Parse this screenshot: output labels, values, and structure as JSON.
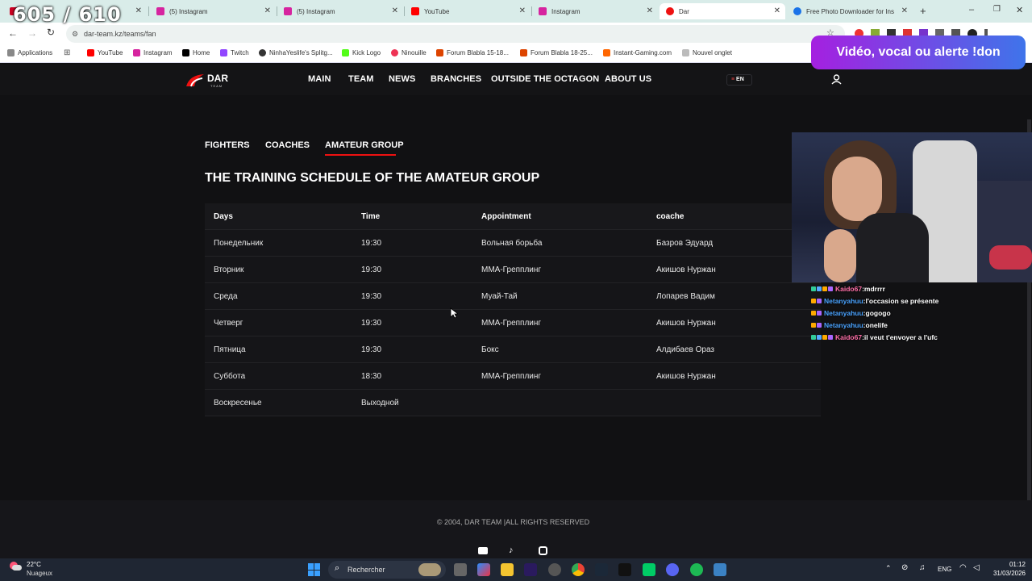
{
  "browser": {
    "tabs": [
      {
        "label": "",
        "fav": "#c02",
        "active": false
      },
      {
        "label": "(5) Instagram",
        "fav": "#d6249f",
        "active": false
      },
      {
        "label": "(5) Instagram",
        "fav": "#d6249f",
        "active": false
      },
      {
        "label": "YouTube",
        "fav": "#f00",
        "active": false
      },
      {
        "label": "Instagram",
        "fav": "#d6249f",
        "active": false
      },
      {
        "label": "Dar",
        "fav": "#e11",
        "active": true
      },
      {
        "label": "Free Photo Downloader for Ins",
        "fav": "#1a73e8",
        "active": false
      }
    ],
    "url": "dar-team.kz/teams/fan",
    "bookmarks": [
      "Applications",
      "YouTube",
      "Instagram",
      "Home",
      "Twitch",
      "NinhaYeslife's Splitg...",
      "Kick Logo",
      "Ninouille",
      "Forum Blabla 15-18...",
      "Forum Blabla 18-25...",
      "Instant-Gaming.com",
      "Nouvel onglet"
    ]
  },
  "site": {
    "logo_text": "DAR",
    "logo_sub": "TEAM",
    "nav": [
      "MAIN",
      "TEAM",
      "NEWS",
      "BRANCHES",
      "OUTSIDE THE OCTAGON",
      "ABOUT US"
    ],
    "lang": "EN",
    "subtabs": [
      "FIGHTERS",
      "COACHES",
      "AMATEUR GROUP"
    ],
    "schedule_title": "THE TRAINING SCHEDULE OF THE AMATEUR GROUP",
    "table": {
      "headers": [
        "Days",
        "Time",
        "Appointment",
        "coache"
      ],
      "rows": [
        [
          "Понедельник",
          "19:30",
          "Вольная борьба",
          "Базров Эдуард"
        ],
        [
          "Вторник",
          "19:30",
          "ММА-Грепплинг",
          "Акишов Нуржан"
        ],
        [
          "Среда",
          "19:30",
          "Муай-Тай",
          "Лопарев Вадим"
        ],
        [
          "Четверг",
          "19:30",
          "ММА-Грепплинг",
          "Акишов Нуржан"
        ],
        [
          "Пятница",
          "19:30",
          "Бокс",
          "Алдибаев Ораз"
        ],
        [
          "Суббота",
          "18:30",
          "ММА-Грепплинг",
          "Акишов Нуржан"
        ],
        [
          "Воскресенье",
          "Выходной",
          "",
          ""
        ]
      ]
    },
    "footer": "© 2004, DAR TEAM |ALL RIGHTS RESERVED"
  },
  "stream": {
    "counter": "605 / 610",
    "donate": "Vidéo, vocal ou alerte !don",
    "chat": [
      {
        "user": "Kaido67",
        "color": "#ff6fa8",
        "text": "mdrrrr"
      },
      {
        "user": "Netanyahuu",
        "color": "#4aa3ff",
        "text": "l'occasion se présente"
      },
      {
        "user": "Netanyahuu",
        "color": "#4aa3ff",
        "text": "gogogo"
      },
      {
        "user": "Netanyahuu",
        "color": "#4aa3ff",
        "text": "onelife"
      },
      {
        "user": "Kaido67",
        "color": "#ff6fa8",
        "text": "il veut t'envoyer a l'ufc"
      }
    ]
  },
  "taskbar": {
    "temp": "22°C",
    "weather": "Nuageux",
    "search": "Rechercher",
    "lang": "ENG",
    "time": "01:12",
    "date": "31/03/2026"
  }
}
